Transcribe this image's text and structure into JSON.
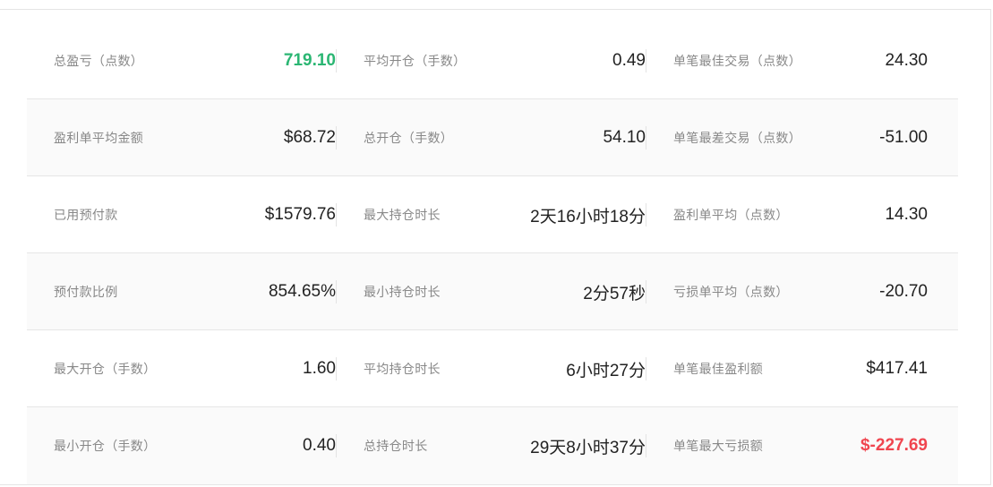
{
  "colors": {
    "positive": "#2bb673",
    "negative": "#f0454f",
    "label": "#888888",
    "value": "#222222",
    "row_alt_bg": "#fafafa"
  },
  "stats": {
    "rows": [
      [
        {
          "label": "总盈亏（点数）",
          "value": "719.10",
          "tone": "positive"
        },
        {
          "label": "平均开仓（手数）",
          "value": "0.49",
          "tone": "neutral"
        },
        {
          "label": "单笔最佳交易（点数）",
          "value": "24.30",
          "tone": "neutral"
        }
      ],
      [
        {
          "label": "盈利单平均金额",
          "value": "$68.72",
          "tone": "neutral"
        },
        {
          "label": "总开仓（手数）",
          "value": "54.10",
          "tone": "neutral"
        },
        {
          "label": "单笔最差交易（点数）",
          "value": "-51.00",
          "tone": "neutral"
        }
      ],
      [
        {
          "label": "已用预付款",
          "value": "$1579.76",
          "tone": "neutral"
        },
        {
          "label": "最大持仓时长",
          "value": "2天16小时18分",
          "tone": "neutral"
        },
        {
          "label": "盈利单平均（点数）",
          "value": "14.30",
          "tone": "neutral"
        }
      ],
      [
        {
          "label": "预付款比例",
          "value": "854.65%",
          "tone": "neutral"
        },
        {
          "label": "最小持仓时长",
          "value": "2分57秒",
          "tone": "neutral"
        },
        {
          "label": "亏损单平均（点数）",
          "value": "-20.70",
          "tone": "neutral"
        }
      ],
      [
        {
          "label": "最大开仓（手数）",
          "value": "1.60",
          "tone": "neutral"
        },
        {
          "label": "平均持仓时长",
          "value": "6小时27分",
          "tone": "neutral"
        },
        {
          "label": "单笔最佳盈利额",
          "value": "$417.41",
          "tone": "neutral"
        }
      ],
      [
        {
          "label": "最小开仓（手数）",
          "value": "0.40",
          "tone": "neutral"
        },
        {
          "label": "总持仓时长",
          "value": "29天8小时37分",
          "tone": "neutral"
        },
        {
          "label": "单笔最大亏损额",
          "value": "$-227.69",
          "tone": "negative"
        }
      ]
    ]
  }
}
